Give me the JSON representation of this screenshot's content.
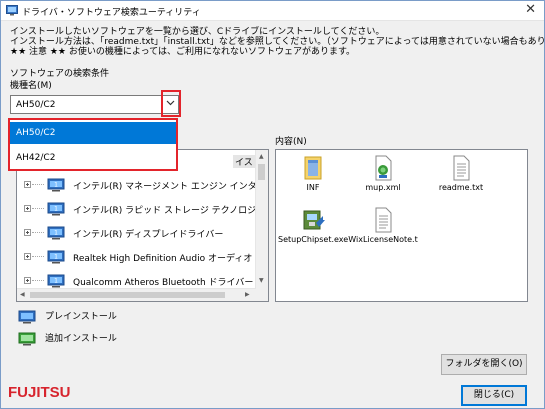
{
  "window": {
    "title": "ドライバ・ソフトウェア検索ユーティリティ",
    "close_glyph": "✕"
  },
  "intro": {
    "line1": "インストールしたいソフトウェアを一覧から選び、Cドライブにインストールしてください。",
    "line2": "インストール方法は、「readme.txt」「install.txt」などを参照してください。（ソフトウェアによっては用意されていない場合もあります）",
    "line3": "★★ 注意 ★★ お使いの機種によっては、ご利用になれないソフトウェアがあります。"
  },
  "search": {
    "section_label": "ソフトウェアの検索条件",
    "model_label": "機種名(M)",
    "model_value": "AH50/C2",
    "model_options": [
      "AH50/C2",
      "AH42/C2"
    ]
  },
  "content_label": "内容(N)",
  "tree": {
    "first_partial": "イス ソフトウェア",
    "items": [
      "インテル(R) マネージメント エンジン インターフェイ",
      "インテル(R) ラピッド ストレージ テクノロジー",
      "インテル(R) ディスプレイドライバー",
      "Realtek High Definition Audio オーディオドライバ",
      "Qualcomm Atheros Bluetooth ドライバー"
    ]
  },
  "files": [
    {
      "name": "INF",
      "icon": "folder-icon"
    },
    {
      "name": "mup.xml",
      "icon": "xml-file-icon"
    },
    {
      "name": "readme.txt",
      "icon": "text-file-icon"
    },
    {
      "name": "SetupChipset.exe",
      "icon": "installer-icon"
    },
    {
      "name": "WixLicenseNote.t",
      "icon": "text-file-icon"
    }
  ],
  "legend": {
    "preinstall": "プレインストール",
    "additional": "追加インストール"
  },
  "buttons": {
    "open_folder": "フォルダを開く(O)",
    "close": "閉じる(C)"
  },
  "brand": {
    "logo": "FUJITSU",
    "color": "#d7242d"
  },
  "colors": {
    "highlight_red": "#e3242b",
    "selection_blue": "#0078d7"
  }
}
